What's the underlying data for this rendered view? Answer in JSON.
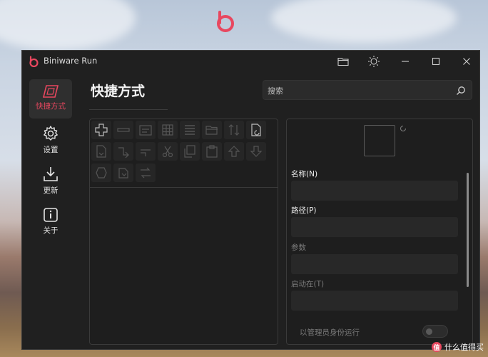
{
  "window": {
    "title": "Biniware Run"
  },
  "brand_color": "#e8475f",
  "titlebar_icons": [
    "folder-icon",
    "theme-sun-icon",
    "minimize-icon",
    "maximize-icon",
    "close-icon"
  ],
  "sidebar": {
    "items": [
      {
        "label": "快捷方式",
        "icon": "shortcut-icon",
        "active": true
      },
      {
        "label": "设置",
        "icon": "gear-icon"
      },
      {
        "label": "更新",
        "icon": "download-icon"
      },
      {
        "label": "关于",
        "icon": "info-icon"
      }
    ]
  },
  "main": {
    "title": "快捷方式",
    "search": {
      "placeholder": "搜索",
      "value": ""
    }
  },
  "toolbar_icons": [
    "add-icon",
    "remove-icon",
    "edit-icon",
    "grid-icon",
    "list-icon",
    "folder-open-icon",
    "transfer-icon",
    "new-file-icon",
    "file-export-icon",
    "indent-icon",
    "outdent-icon",
    "cut-icon",
    "copy-icon",
    "paste-icon",
    "move-up-icon",
    "move-down-icon",
    "file-import-icon",
    "import-icon",
    "export-icon"
  ],
  "detail": {
    "fields": [
      {
        "label": "名称(N)",
        "enabled": true,
        "value": ""
      },
      {
        "label": "路径(P)",
        "enabled": true,
        "value": ""
      },
      {
        "label": "参数",
        "enabled": false,
        "value": ""
      },
      {
        "label": "启动在(T)",
        "enabled": false,
        "value": ""
      }
    ],
    "admin_toggle": {
      "label": "以管理员身份运行",
      "on": false
    }
  },
  "watermark": {
    "text": "什么值得买",
    "badge": "值"
  }
}
